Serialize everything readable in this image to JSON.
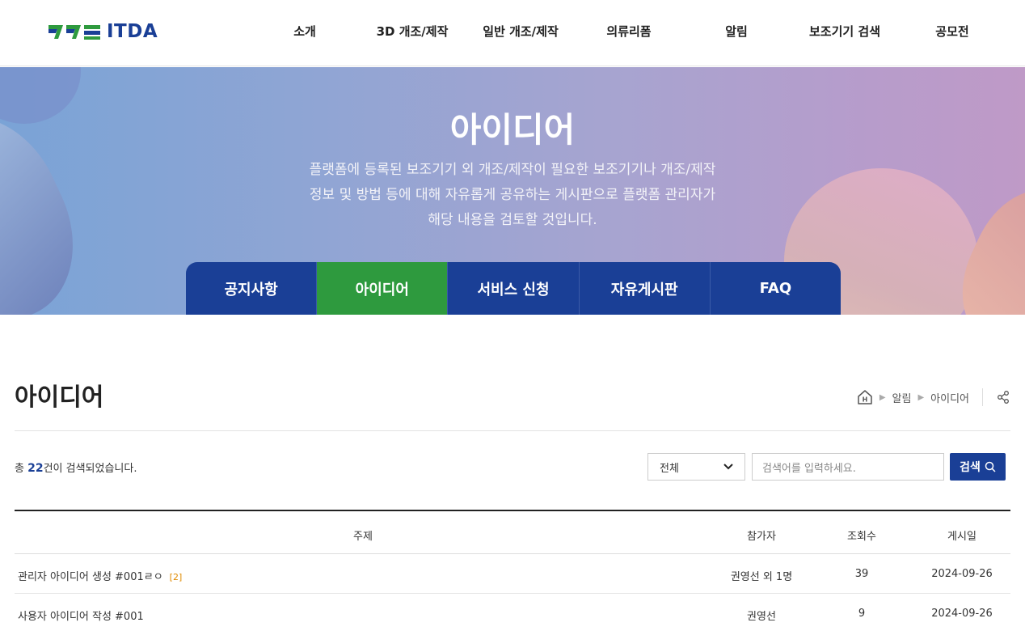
{
  "header": {
    "logo_text": "ITDA",
    "nav": [
      "소개",
      "3D 개조/제작",
      "일반 개조/제작",
      "의류리폼",
      "알림",
      "보조기기 검색",
      "공모전"
    ]
  },
  "banner": {
    "title": "아이디어",
    "description_lines": [
      "플랫폼에 등록된 보조기기 외 개조/제작이 필요한 보조기기나 개조/제작",
      "정보 및 방법 등에 대해 자유롭게 공유하는 게시판으로 플랫폼 관리자가",
      "해당 내용을 검토할 것입니다."
    ],
    "tabs": [
      "공지사항",
      "아이디어",
      "서비스 신청",
      "자유게시판",
      "FAQ"
    ],
    "active_tab": "아이디어"
  },
  "page": {
    "title": "아이디어",
    "breadcrumb": [
      "알림",
      "아이디어"
    ]
  },
  "search": {
    "total_prefix": "총 ",
    "total_count": "22",
    "total_suffix": "건이 검색되었습니다.",
    "select_value": "전체",
    "input_placeholder": "검색어를 입력하세요.",
    "button_label": "검색"
  },
  "table": {
    "columns": [
      "주제",
      "참가자",
      "조회수",
      "게시일"
    ],
    "rows": [
      {
        "subject": "관리자 아이디어 생성 #001ㄹㅇ",
        "comments": "[2]",
        "participants": "권영선 외 1명",
        "views": "39",
        "date": "2024-09-26"
      },
      {
        "subject": "사용자 아이디어 작성 #001",
        "comments": "",
        "participants": "권영선",
        "views": "9",
        "date": "2024-09-26"
      }
    ]
  },
  "colors": {
    "brand_blue": "#1a3f96",
    "brand_green": "#2e9a3e"
  }
}
